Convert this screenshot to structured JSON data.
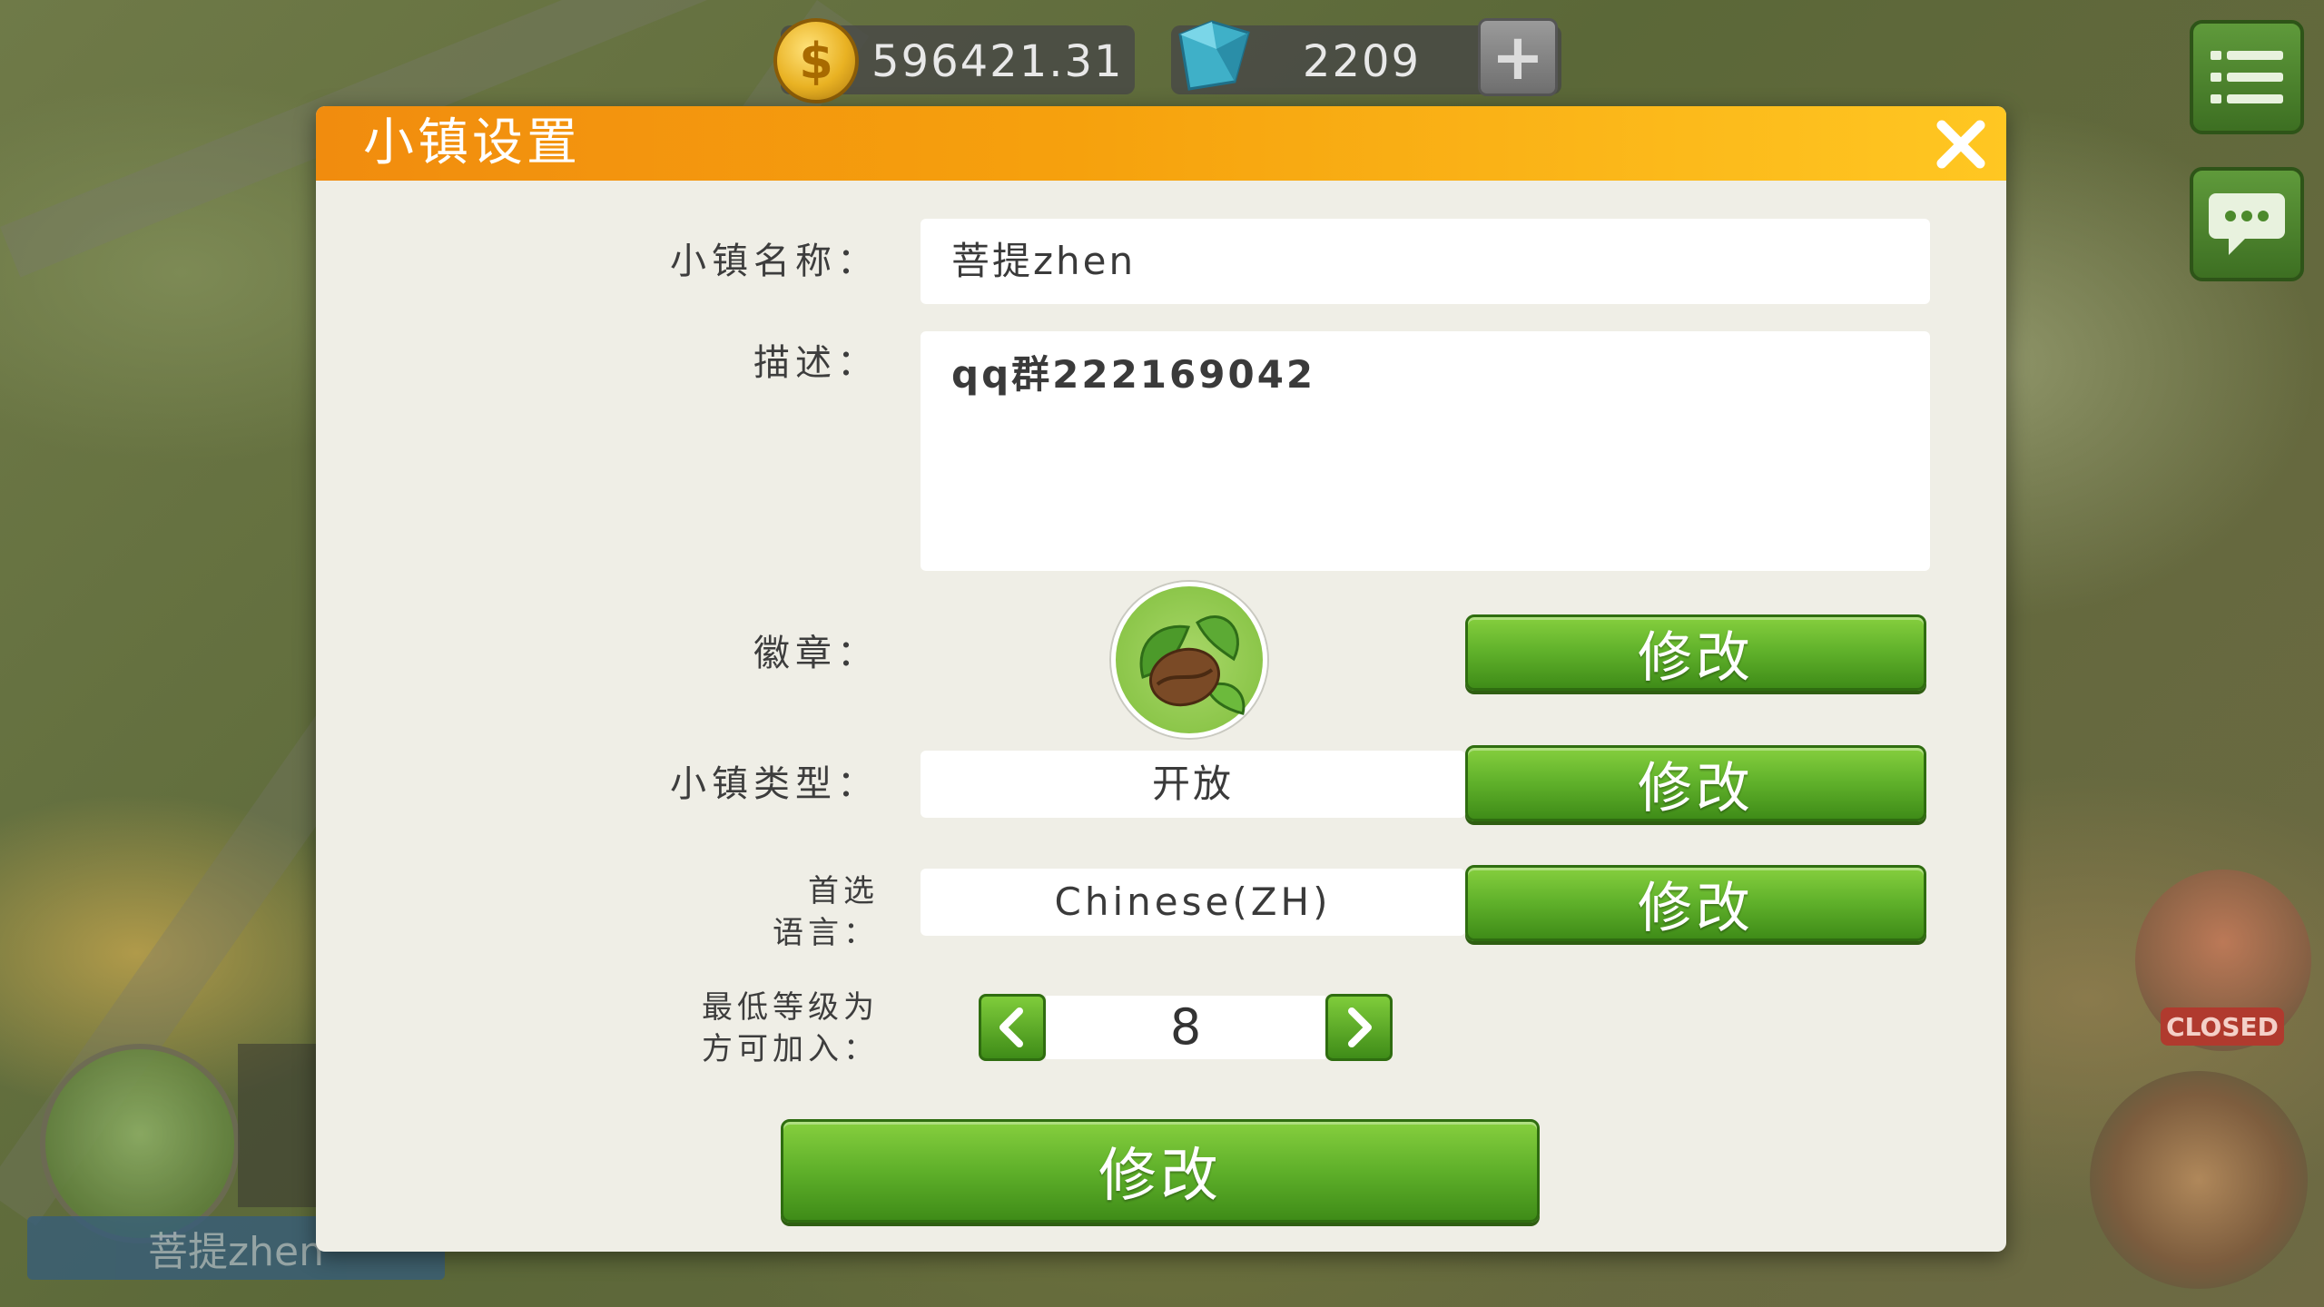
{
  "hud": {
    "coins": "596421.31",
    "gems": "2209",
    "plus": "+"
  },
  "dialog": {
    "title": "小镇设置",
    "name_label": "小镇名称：",
    "name_value": "菩提zhen",
    "desc_label": "描述：",
    "desc_value": "qq群222169042",
    "badge_label": "徽章：",
    "type_label": "小镇类型：",
    "type_value": "开放",
    "lang_label_line1": "首选",
    "lang_label_line2": "语言：",
    "lang_value": "Chinese(ZH)",
    "level_label_line1": "最低等级为",
    "level_label_line2": "方可加入：",
    "min_level": "8",
    "modify_label": "修改",
    "submit_label": "修改"
  },
  "background": {
    "closed_tag": "CLOSED",
    "town_name": "菩提zhen"
  },
  "colors": {
    "header_orange": "#f6a10d",
    "button_green": "#5fb02a",
    "panel_bg": "#efeee6"
  }
}
